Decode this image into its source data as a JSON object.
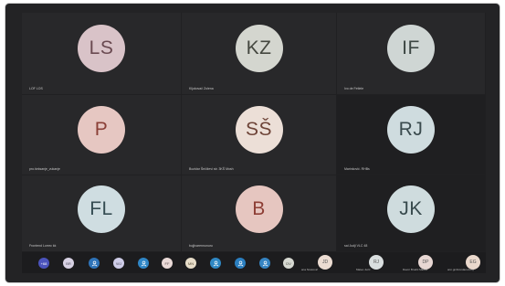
{
  "tiles": [
    {
      "initials": "LS",
      "name": "LOF LOS",
      "bg": "#d9c3c8",
      "fg": "#6a4a51"
    },
    {
      "initials": "KZ",
      "name": "Kljukovač Zolena",
      "bg": "#d4d6cf",
      "fg": "#454840"
    },
    {
      "initials": "IF",
      "name": "Ivo de Fetlele",
      "bg": "#cfd6d4",
      "fg": "#3d4744"
    },
    {
      "initials": "P",
      "name": "pro.šeksanje_vukanje",
      "bg": "#e6c7c2",
      "fg": "#8a3f37"
    },
    {
      "initials": "SŠ",
      "name": "Bozidar Šečiževi str. 3KŠ Mosh",
      "bg": "#ecdfd7",
      "fg": "#6e4438"
    },
    {
      "initials": "RJ",
      "name": "Marinković. RHBs",
      "bg": "#cfdcdf",
      "fg": "#3b4b4e"
    },
    {
      "initials": "FL",
      "name": "Frontend Lorrec kk",
      "bg": "#cfdde1",
      "fg": "#354c52"
    },
    {
      "initials": "B",
      "name": "bujjivarennunuru",
      "bg": "#e6c6c0",
      "fg": "#8d3e35"
    },
    {
      "initials": "JK",
      "name": "sal Judji VLC 48",
      "bg": "#cfdcde",
      "fg": "#384a4d"
    }
  ],
  "strip": {
    "more_count": "+68",
    "dots": [
      {
        "label": "BR",
        "color": "#d8d2e4",
        "icon": "initials"
      },
      {
        "label": "",
        "color": "#2e73b8",
        "icon": "person-icon"
      },
      {
        "label": "WJ",
        "color": "#cfcde8",
        "icon": "initials"
      },
      {
        "label": "",
        "color": "#2f86c6",
        "icon": "person-icon"
      },
      {
        "label": "FF",
        "color": "#eadad8",
        "icon": "initials"
      },
      {
        "label": "MN",
        "color": "#e6dcc8",
        "icon": "initials"
      },
      {
        "label": "",
        "color": "#2f88c4",
        "icon": "person-icon"
      },
      {
        "label": "",
        "color": "#2b7fc0",
        "icon": "person-icon"
      },
      {
        "label": "",
        "color": "#3584c2",
        "icon": "person-icon"
      },
      {
        "label": "DV",
        "color": "#d7d9d2",
        "icon": "initials"
      }
    ],
    "minis": [
      {
        "label": "JD",
        "name": "ana Novković",
        "color": "#ecdcd2"
      },
      {
        "label": "RJ",
        "name": "Mateo Jurić",
        "color": "#d9dedf"
      },
      {
        "label": "DP",
        "name": "Davor Brodić MEHR",
        "color": "#e8d7d3"
      },
      {
        "label": "EG",
        "name": "ann.gmbrondanozony",
        "color": "#ead8cc"
      }
    ]
  },
  "colors": {
    "more_button": "#4b53bc",
    "bezel": "#232325"
  }
}
